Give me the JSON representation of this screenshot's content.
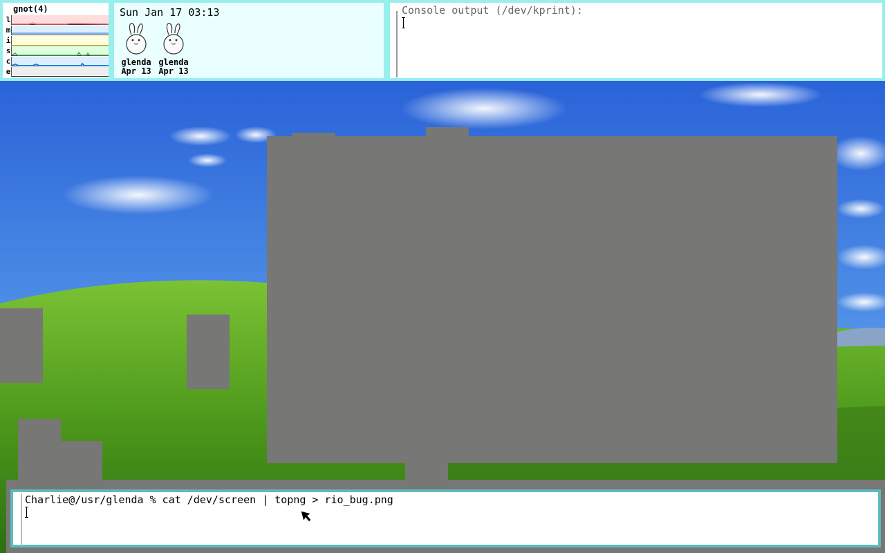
{
  "stats": {
    "title": "gnot(4)",
    "rows": [
      {
        "label": "l",
        "color": "#e06060",
        "bg": "#ffdddd"
      },
      {
        "label": "m",
        "color": "#60a0e0",
        "bg": "#ddeeff"
      },
      {
        "label": "i",
        "color": "#e0c040",
        "bg": "#ffffdd"
      },
      {
        "label": "s",
        "color": "#40a040",
        "bg": "#ddffdd"
      },
      {
        "label": "c",
        "color": "#2080e0",
        "bg": "#ddeeff"
      },
      {
        "label": "e",
        "color": "#999999",
        "bg": "#eeeeee"
      }
    ]
  },
  "faces": {
    "clock": "Sun Jan 17 03:13",
    "items": [
      {
        "name": "glenda",
        "date": "Apr 13"
      },
      {
        "name": "glenda",
        "date": "Apr 13"
      }
    ]
  },
  "console": {
    "title": "Console output (/dev/kprint):"
  },
  "terminal": {
    "prompt_line": "Charlie@/usr/glenda % cat /dev/screen | topng > rio_bug.png"
  },
  "colors": {
    "window_border": "#99eeee",
    "terminal_border": "#5dbcbc",
    "grey_window": "#777775"
  }
}
